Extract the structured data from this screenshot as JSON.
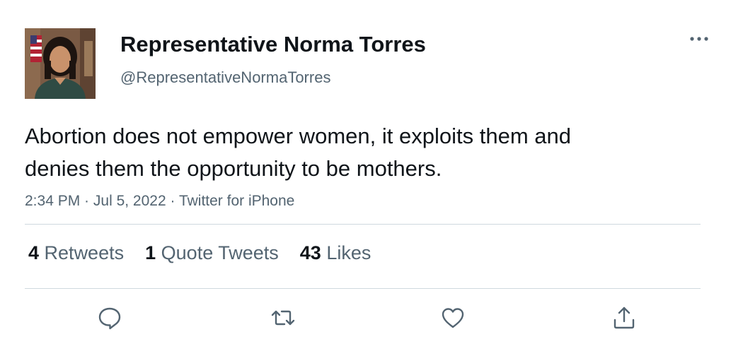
{
  "tweet": {
    "author": {
      "display_name": "Representative Norma Torres",
      "handle": "@RepresentativeNormaTorres",
      "avatar_icon": "profile-photo"
    },
    "text": "Abortion does not empower women, it exploits them and\ndenies them the opportunity to be mothers.",
    "meta": {
      "time": "2:34 PM",
      "separator": " · ",
      "date": "Jul 5, 2022",
      "source": "Twitter for iPhone"
    },
    "stats": {
      "retweets": {
        "count": "4",
        "label": "Retweets"
      },
      "quote_tweets": {
        "count": "1",
        "label": "Quote Tweets"
      },
      "likes": {
        "count": "43",
        "label": "Likes"
      }
    },
    "actions": [
      {
        "icon": "reply-icon"
      },
      {
        "icon": "retweet-icon"
      },
      {
        "icon": "like-icon"
      },
      {
        "icon": "share-icon"
      }
    ]
  },
  "colors": {
    "text_primary": "#0f1419",
    "text_secondary": "#536471",
    "divider": "#cfd9de"
  }
}
